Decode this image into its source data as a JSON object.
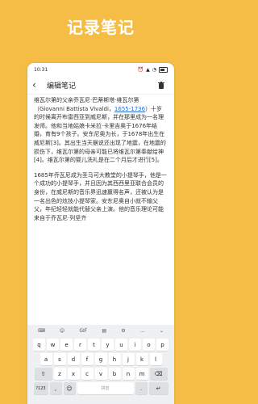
{
  "headline": "记录笔记",
  "status": {
    "time": "10:31"
  },
  "appbar": {
    "title": "编辑笔记"
  },
  "note": {
    "p1_before": "维瓦尔第的父亲乔瓦尼·巴蒂斯塔·维瓦尔第（Giovanni Battista Vivaldi，",
    "p1_link": "1655-1736",
    "p1_after": "）十岁的时候离开布雷西亚到威尼斯，并在那里成为一名理发师。他和当地姑娘卡米拉·卡里吉奥于1676年结婚，育有9个孩子。安东尼奥为长，于1678年出生在威尼斯[3]。其出生当天据说还出现了地震，在地震的损伤下，维瓦尔第的母亲可能已将维瓦尔第奉献给神[4]。维瓦尔第的婴儿洗礼是在二个月后才进行[5]。",
    "p2": "1685年乔瓦尼成为圣马可大教堂的小提琴手，他是一个成功的小提琴手，并且因为其西西里亚联合会员的身份，在威尼斯的音乐界迅速赢得名声，还被认为是一名出色的炫技小提琴家。安东尼奥自小就不输父父，年纪轻轻就能代替父亲上演。他的音乐理论可能来自于乔瓦尼·列坚齐"
  },
  "keyboard": {
    "toolbar": [
      "⌨",
      "☺",
      "GIF",
      "▤",
      "⚙",
      "…",
      "⌄"
    ],
    "row1": [
      "q",
      "w",
      "e",
      "r",
      "t",
      "y",
      "u",
      "i",
      "o",
      "p"
    ],
    "row2": [
      "a",
      "s",
      "d",
      "f",
      "g",
      "h",
      "j",
      "k",
      "l"
    ],
    "row3": [
      "z",
      "x",
      "c",
      "v",
      "b",
      "n",
      "m"
    ],
    "shift": "⇧",
    "backspace": "⌫",
    "numkey": "?123",
    "comma": ",",
    "globe": "☺",
    "space": "拼音",
    "period": ".",
    "enter": "↵"
  }
}
